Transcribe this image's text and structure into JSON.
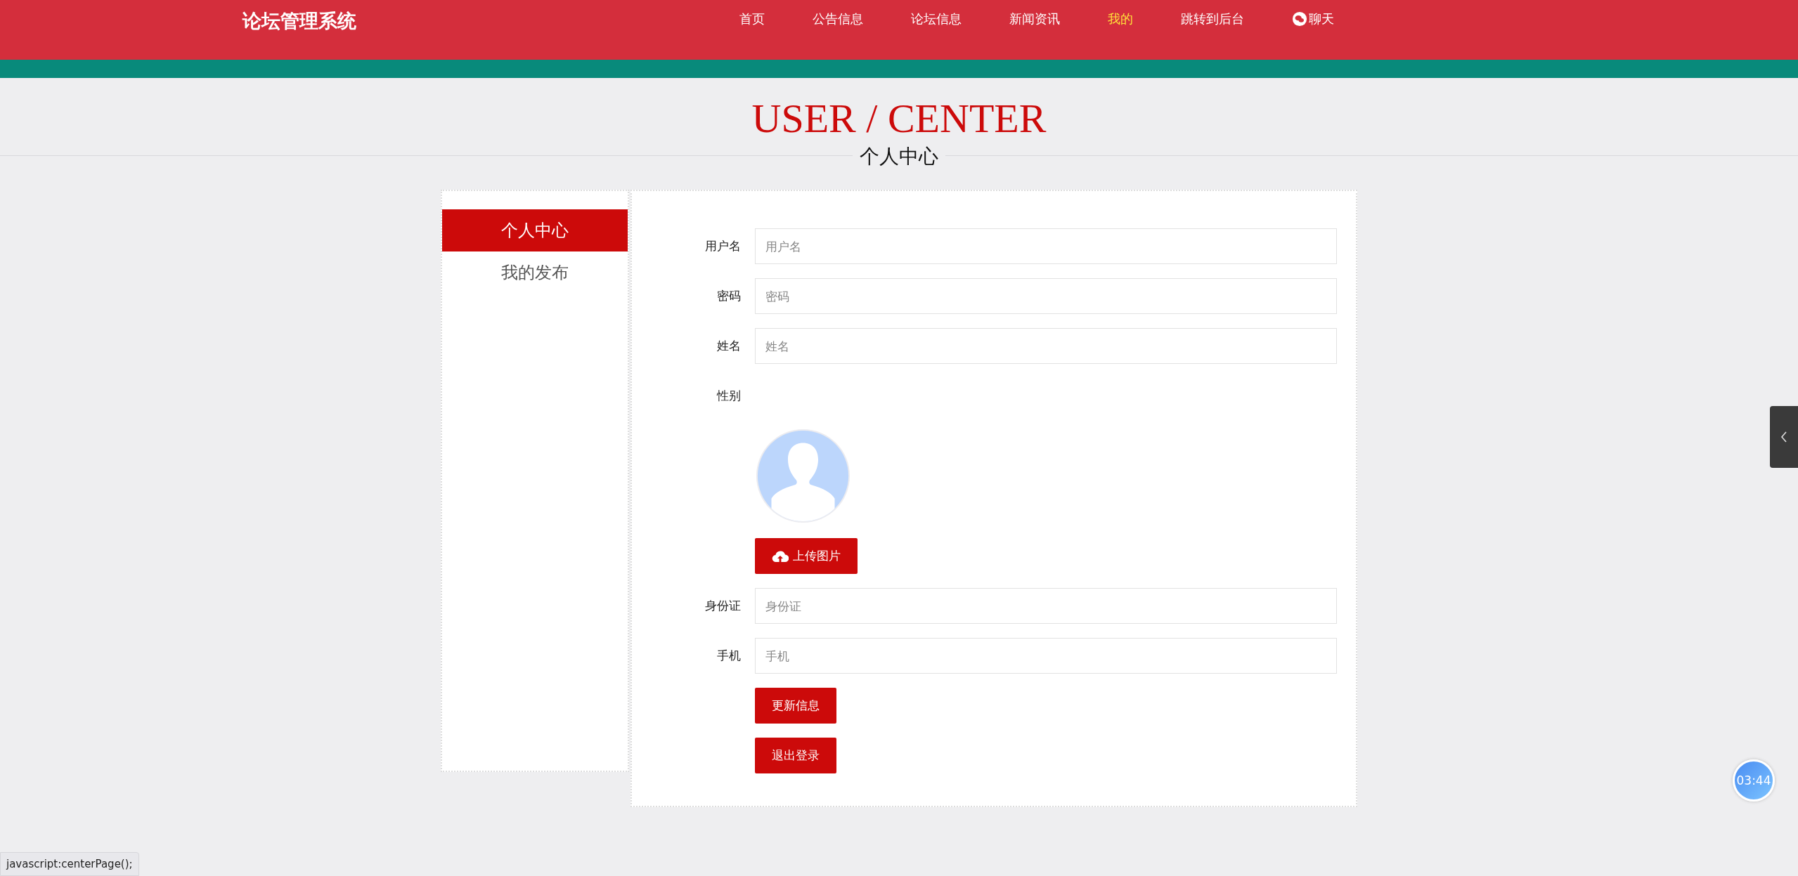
{
  "header": {
    "logo": "论坛管理系统",
    "nav": [
      {
        "label": "首页",
        "kind": "link",
        "selected": false
      },
      {
        "label": "公告信息",
        "kind": "link",
        "selected": false
      },
      {
        "label": "论坛信息",
        "kind": "link",
        "selected": false
      },
      {
        "label": "新闻资讯",
        "kind": "link",
        "selected": false
      },
      {
        "label": "我的",
        "kind": "link",
        "selected": true
      },
      {
        "label": "跳转到后台",
        "kind": "link",
        "selected": false
      },
      {
        "label": "聊天",
        "kind": "chat",
        "selected": false
      }
    ]
  },
  "page_title": {
    "title": "USER / CENTER",
    "subtitle": "个人中心"
  },
  "sidebar": {
    "items": [
      {
        "label": "个人中心",
        "selected": true
      },
      {
        "label": "我的发布",
        "selected": false
      }
    ]
  },
  "form": {
    "rows": [
      {
        "kind": "input",
        "label": "用户名",
        "placeholder": "用户名"
      },
      {
        "kind": "input",
        "label": "密码",
        "placeholder": "密码"
      },
      {
        "kind": "input",
        "label": "姓名",
        "placeholder": "姓名"
      },
      {
        "kind": "label",
        "label": "性别"
      },
      {
        "kind": "avatar"
      },
      {
        "kind": "upload",
        "label": "上传图片"
      },
      {
        "kind": "input",
        "label": "身份证",
        "placeholder": "身份证"
      },
      {
        "kind": "input",
        "label": "手机",
        "placeholder": "手机"
      },
      {
        "kind": "button",
        "label": "更新信息"
      },
      {
        "kind": "button",
        "label": "退出登录"
      }
    ]
  },
  "timer": "03:44",
  "status_bar": "javascript:centerPage();"
}
